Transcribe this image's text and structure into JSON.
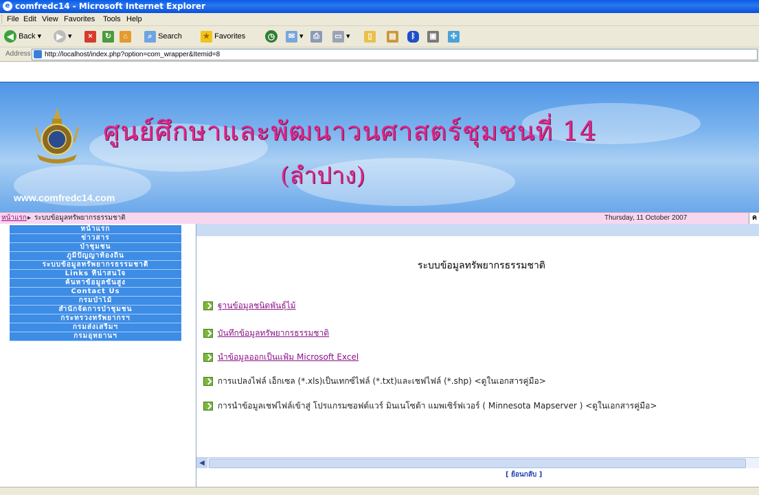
{
  "window": {
    "title": "comfredc14 - Microsoft Internet Explorer"
  },
  "menu": {
    "items": [
      "File",
      "Edit",
      "View",
      "Favorites",
      "Tools",
      "Help"
    ]
  },
  "toolbar": {
    "back_label": "Back",
    "search_label": "Search",
    "favorites_label": "Favorites"
  },
  "address": {
    "label": "Address",
    "url": "http://localhost/index.php?option=com_wrapper&Itemid=8"
  },
  "banner": {
    "title": "ศูนย์ศึกษาและพัฒนาวนศาสตร์ชุมชนที่ 14",
    "subtitle": "(ลำปาง)",
    "url": "www.comfredc14.com"
  },
  "breadcrumb": {
    "home": "หน้าแรก",
    "current": "ระบบข้อมูลทรัพยากรธรรมชาติ",
    "date": "Thursday, 11 October 2007",
    "edge": "ค"
  },
  "left_menu": {
    "items": [
      "หน้าแรก",
      "ข่าวสาร",
      "ป่าชุมชน",
      "ภูมิปัญญาท้องถิ่น",
      "ระบบข้อมูลทรัพยากรธรรมชาติ",
      "Links ที่น่าสนใจ",
      "ค้นหาข้อมูลขั้นสูง",
      "Contact Us",
      "กรมป่าไม้",
      "สำนักจัดการป่าชุมชน",
      "กระทรวงทรัพยากรฯ",
      "กรมส่งเสริมฯ",
      "กรมอุทยานฯ"
    ]
  },
  "main": {
    "heading": "ระบบข้อมูลทรัพยากรธรรมชาติ",
    "links": [
      "ฐานข้อมูลชนิดพันธุ์ไม้",
      "บันทึกข้อมูลทรัพยากรธรรมชาติ",
      "นำข้อมูลออกเป็นแฟ้ม Microsoft Excel"
    ],
    "notes": [
      "การแปลงไฟล์ เอ็กเซล (*.xls)เป็นเทกซ์ไฟล์ (*.txt)และเชฟไฟล์ (*.shp) <ดูในเอกสารคู่มือ>",
      "การนำข้อมูลเชฟไฟล์เข้าสู่ โปรแกรมซอฟต์แวร์ มินเนโซต้า แมพเซิร์ฟเวอร์ ( Minnesota Mapserver ) <ดูในเอกสารคู่มือ>"
    ],
    "back": "[ ย้อนกลับ ]"
  },
  "colors": {
    "titlebar": "#0a5be6",
    "menu_blue": "#3d8ce6",
    "banner_pink": "#e0258a",
    "crumb_bg": "#f7d6f0",
    "link": "#8a1185"
  }
}
